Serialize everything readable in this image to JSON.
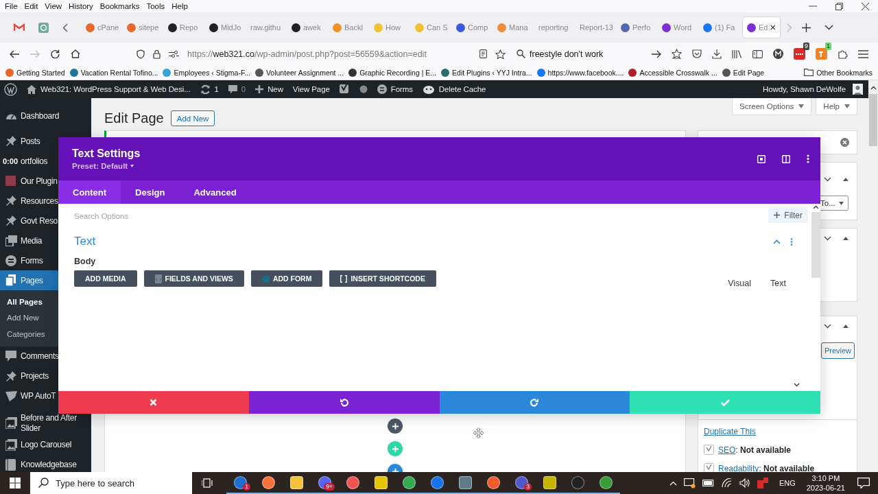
{
  "menu_bar": [
    "File",
    "Edit",
    "View",
    "History",
    "Bookmarks",
    "Tools",
    "Help"
  ],
  "tabs": [
    {
      "label": "cPane",
      "selected": false
    },
    {
      "label": "sitepe",
      "selected": false
    },
    {
      "label": "Repo",
      "selected": false
    },
    {
      "label": "MidJo",
      "selected": false
    },
    {
      "label": "raw.githu",
      "selected": false
    },
    {
      "label": "awek",
      "selected": false
    },
    {
      "label": "Backl",
      "selected": false
    },
    {
      "label": "How",
      "selected": false
    },
    {
      "label": "Can S",
      "selected": false
    },
    {
      "label": "Comp",
      "selected": false
    },
    {
      "label": "Mana",
      "selected": false
    },
    {
      "label": "reporting",
      "selected": false
    },
    {
      "label": "Report-13",
      "selected": false
    },
    {
      "label": "Perfo",
      "selected": false
    },
    {
      "label": "Word",
      "selected": false
    },
    {
      "label": "(1) Fa",
      "selected": false
    },
    {
      "label": "Ed",
      "selected": true
    }
  ],
  "address_bar": {
    "scheme": "https://",
    "domain": "web321.co",
    "path": "/wp-admin/post.php?post=56559&action=edit"
  },
  "search_field": {
    "value": "freestyle don't work"
  },
  "extension_badges": [
    "9",
    "1"
  ],
  "bookmarks": [
    "Getting Started",
    "Vacation Rental Tofino...",
    "Employees ‹ Stigma-F...",
    "Volunteer Assignment ...",
    "Graphic Recording | E...",
    "Edit Plugins ‹ YYJ Intra...",
    "https://www.facebook....",
    "Accessible Crosswalk ...",
    "Edit Page"
  ],
  "other_bookmarks": "Other Bookmarks",
  "admin_bar": {
    "site": "Web321: WordPress Support & Web Desi...",
    "updates": "1",
    "comments": "0",
    "new": "New",
    "view_page": "View Page",
    "forms": "Forms",
    "delete_cache": "Delete Cache",
    "howdy": "Howdy, Shawn DeWolfe"
  },
  "sidebar": {
    "items": [
      {
        "label": "Dashboard",
        "selected": false
      },
      {
        "label": "Posts",
        "selected": false
      },
      {
        "label": "ortfolios",
        "selected": false,
        "overlay": "0:00"
      },
      {
        "label": "Our Plugin",
        "selected": false
      },
      {
        "label": "Resources",
        "selected": false
      },
      {
        "label": "Govt Reso",
        "selected": false
      },
      {
        "label": "Media",
        "selected": false
      },
      {
        "label": "Forms",
        "selected": false
      },
      {
        "label": "Pages",
        "selected": true,
        "children": [
          {
            "label": "All Pages",
            "selected": true
          },
          {
            "label": "Add New",
            "selected": false
          },
          {
            "label": "Categories",
            "selected": false
          }
        ]
      },
      {
        "label": "Comments",
        "selected": false
      },
      {
        "label": "Projects",
        "selected": false
      },
      {
        "label": "WP AutoT",
        "selected": false
      },
      {
        "label": "Before and After Slider",
        "selected": false
      },
      {
        "label": "Logo Carousel",
        "selected": false
      },
      {
        "label": "Knowledgebase",
        "selected": false
      }
    ]
  },
  "page": {
    "title": "Edit Page",
    "add_new": "Add New",
    "screen_options": "Screen Options",
    "help": "Help"
  },
  "side_panel": {
    "select_value": "To...",
    "preview": "Preview",
    "duplicate": "Duplicate This",
    "statuses": [
      {
        "link": "SEO",
        "text": ": **Not available**"
      },
      {
        "link": "Readability",
        "text": ": **Not available**"
      }
    ]
  },
  "modal": {
    "title": "Text Settings",
    "preset": "Preset: Default",
    "tabs": [
      {
        "label": "Content",
        "selected": true
      },
      {
        "label": "Design",
        "selected": false
      },
      {
        "label": "Advanced",
        "selected": false
      }
    ],
    "search_placeholder": "Search Options",
    "filter": "Filter",
    "section": {
      "title": "Text",
      "expanded": true
    },
    "field_label": "Body",
    "editor_buttons": [
      "ADD MEDIA",
      "FIELDS AND VIEWS",
      "ADD FORM",
      "INSERT SHORTCODE"
    ],
    "editor_tabs": [
      "Visual",
      "Text"
    ]
  },
  "taskbar": {
    "search_placeholder": "Type here to search",
    "apps": [
      {
        "badge": "1",
        "running": true
      },
      {
        "running": true
      },
      {
        "running": true
      },
      {
        "badge": "9+",
        "running": true
      },
      {
        "running": true
      },
      {
        "running": true
      },
      {
        "running": true
      },
      {
        "running": true
      },
      {
        "running": true
      },
      {
        "running": true
      },
      {
        "badge": "3",
        "running": true
      },
      {
        "running": true
      },
      {
        "running": true
      },
      {
        "running": true
      }
    ]
  },
  "tray": {
    "language": "ENG",
    "time": "3:10 PM",
    "date": "2023-06-21"
  }
}
